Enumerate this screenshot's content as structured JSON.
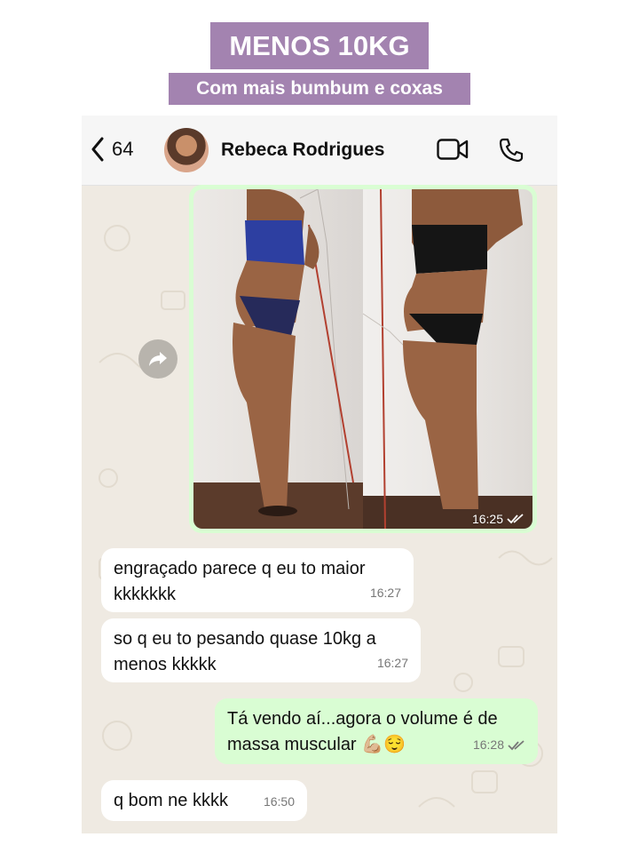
{
  "banner": {
    "title": "MENOS 10KG",
    "subtitle": "Com mais bumbum e coxas"
  },
  "header": {
    "back_count": "64",
    "contact_name": "Rebeca Rodrigues"
  },
  "photo_message": {
    "time": "16:25",
    "status": "read"
  },
  "messages": [
    {
      "direction": "incoming",
      "text": "engraçado parece q eu to maior\nkkkkkkk",
      "time": "16:27"
    },
    {
      "direction": "incoming",
      "text": "so q eu to pesando quase 10kg a\nmenos kkkkk",
      "time": "16:27"
    },
    {
      "direction": "outgoing",
      "text": "Tá vendo aí...agora o volume é de\nmassa muscular 💪🏼😌",
      "time": "16:28",
      "status": "read"
    },
    {
      "direction": "incoming",
      "text": "q bom ne kkkk",
      "time": "16:50"
    }
  ],
  "colors": {
    "banner": "#a383b0",
    "outgoing_bubble": "#d9fdd3",
    "chat_background": "#efeae2",
    "read_tick": "#53bdeb"
  }
}
